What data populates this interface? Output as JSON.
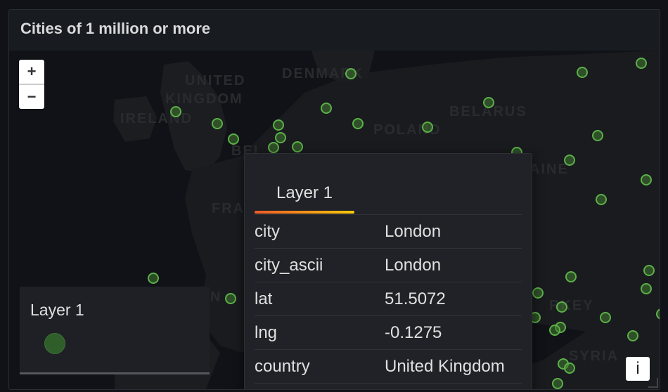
{
  "panel": {
    "title": "Cities of 1 million or more"
  },
  "map": {
    "zoom_in_label": "+",
    "zoom_out_label": "−",
    "place_labels": [
      "UNITED",
      "KINGDOM",
      "IRELAND",
      "DENMARK",
      "BELARUS",
      "POLAND",
      "BEL",
      "FRA",
      "AINE",
      "RKEY",
      "SYRIA",
      "N"
    ],
    "marker_color": "#5bb048",
    "info_label": "i"
  },
  "legend": {
    "title": "Layer 1",
    "dot_color": "#2f5e2b"
  },
  "tooltip": {
    "tab_label": "Layer 1",
    "rows": [
      {
        "key": "city",
        "value": "London"
      },
      {
        "key": "city_ascii",
        "value": "London"
      },
      {
        "key": "lat",
        "value": "51.5072"
      },
      {
        "key": "lng",
        "value": "-0.1275"
      },
      {
        "key": "country",
        "value": "United Kingdom"
      }
    ]
  }
}
